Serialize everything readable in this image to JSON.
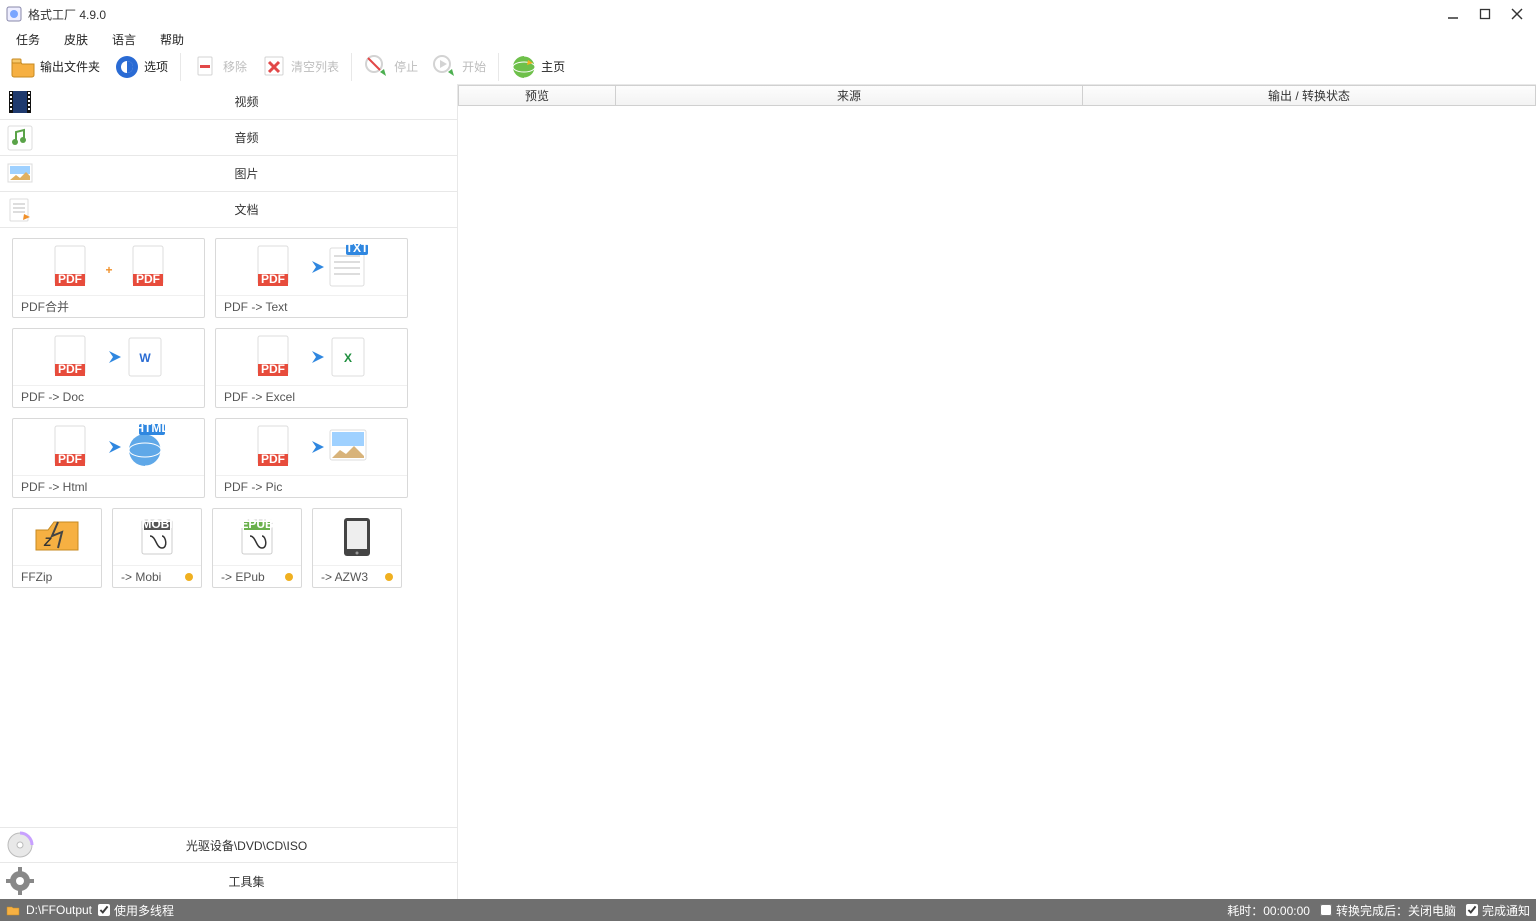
{
  "window": {
    "title": "格式工厂 4.9.0"
  },
  "menubar": {
    "items": [
      "任务",
      "皮肤",
      "语言",
      "帮助"
    ]
  },
  "toolbar": {
    "output_folder": "输出文件夹",
    "options": "选项",
    "remove": "移除",
    "clear_list": "清空列表",
    "stop": "停止",
    "start": "开始",
    "home": "主页"
  },
  "categories": {
    "video": "视频",
    "audio": "音频",
    "picture": "图片",
    "document": "文档",
    "optical": "光驱设备\\DVD\\CD\\ISO",
    "tools": "工具集"
  },
  "doc_cards": {
    "pdf_merge": "PDF合并",
    "pdf_text": "PDF -> Text",
    "pdf_doc": "PDF -> Doc",
    "pdf_excel": "PDF -> Excel",
    "pdf_html": "PDF -> Html",
    "pdf_pic": "PDF -> Pic",
    "ffzip": "FFZip",
    "mobi": "-> Mobi",
    "epub": "-> EPub",
    "azw3": "-> AZW3"
  },
  "columns": {
    "preview": "预览",
    "source": "来源",
    "status": "输出 / 转换状态"
  },
  "statusbar": {
    "output_path": "D:\\FFOutput",
    "multithread": "使用多线程",
    "elapsed_label": "耗时：",
    "elapsed_value": "00:00:00",
    "after_convert": "转换完成后：关闭电脑",
    "notify": "完成通知"
  }
}
